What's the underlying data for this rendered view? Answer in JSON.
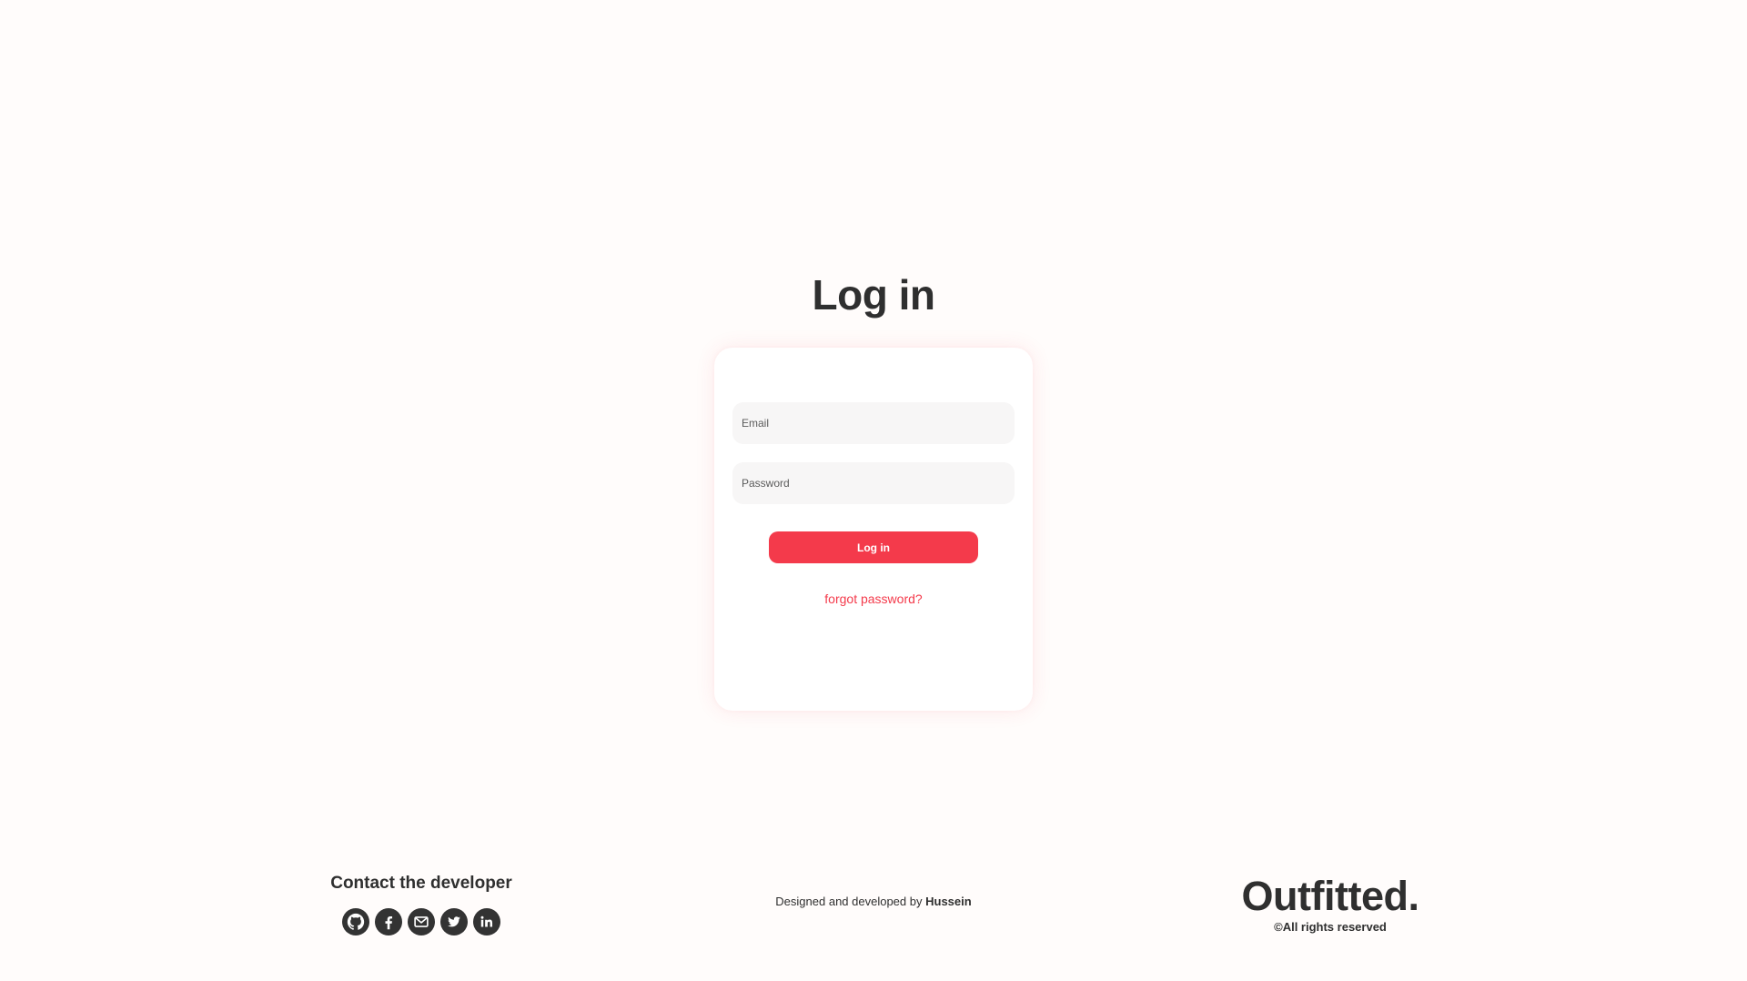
{
  "page": {
    "title": "Log in"
  },
  "form": {
    "email_placeholder": "Email",
    "email_value": "",
    "password_placeholder": "Password",
    "password_value": "",
    "submit_label": "Log in",
    "forgot_label": "forgot password?"
  },
  "footer": {
    "contact_heading": "Contact the developer",
    "social_icons": [
      "github-icon",
      "facebook-icon",
      "gmail-icon",
      "twitter-icon",
      "linkedin-icon"
    ],
    "credit_prefix": "Designed and developed by",
    "credit_name": "Hussein",
    "brand": "Outfitted.",
    "rights": "©All rights reserved"
  },
  "colors": {
    "accent": "#f43a4b",
    "text": "#2f2f2f",
    "background": "#fffcfb",
    "card": "#ffffff",
    "field": "#f7f6f6",
    "icon": "#333333"
  }
}
